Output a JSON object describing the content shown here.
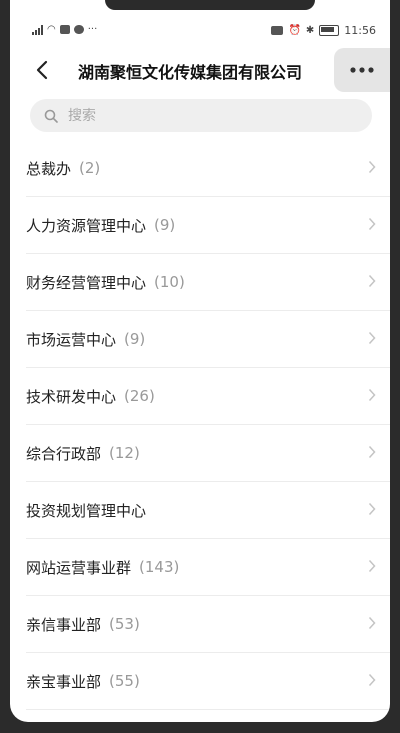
{
  "status_bar": {
    "time": "11:56"
  },
  "header": {
    "title": "湖南聚恒文化传媒集团有限公司"
  },
  "search": {
    "placeholder": "搜索"
  },
  "departments": [
    {
      "name": "总裁办",
      "count": "(2)"
    },
    {
      "name": "人力资源管理中心",
      "count": "(9)"
    },
    {
      "name": "财务经营管理中心",
      "count": "(10)"
    },
    {
      "name": "市场运营中心",
      "count": "(9)"
    },
    {
      "name": "技术研发中心",
      "count": "(26)"
    },
    {
      "name": "综合行政部",
      "count": "(12)"
    },
    {
      "name": "投资规划管理中心",
      "count": ""
    },
    {
      "name": "网站运营事业群",
      "count": "(143)"
    },
    {
      "name": "亲信事业部",
      "count": "(53)"
    },
    {
      "name": "亲宝事业部",
      "count": "(55)"
    }
  ],
  "colors": {
    "accent": "#222222",
    "muted": "#999999",
    "search_bg": "#efefef"
  }
}
